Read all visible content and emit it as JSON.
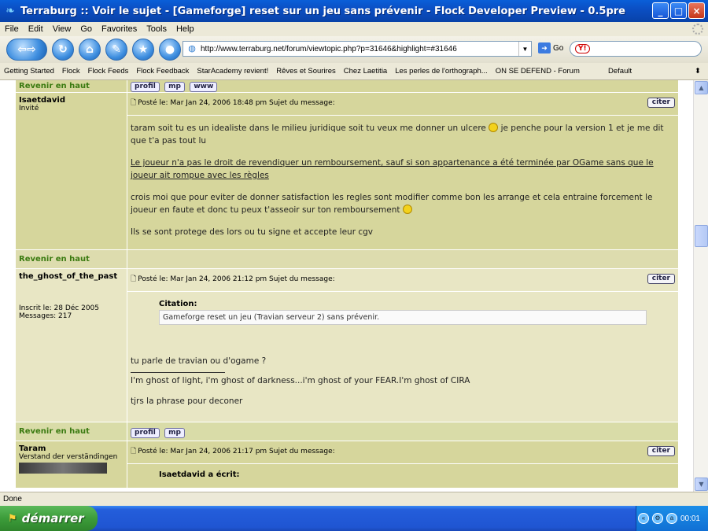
{
  "window": {
    "title": "Terraburg :: Voir le sujet - [Gameforge] reset sur un jeu sans prévenir - Flock Developer Preview - 0.5pre",
    "controls": [
      "_",
      "□",
      "×"
    ]
  },
  "menu": [
    "File",
    "Edit",
    "View",
    "Go",
    "Favorites",
    "Tools",
    "Help"
  ],
  "nav": {
    "url": "http://www.terraburg.net/forum/viewtopic.php?p=31646&highlight=#31646",
    "go_label": "Go",
    "search_engine": "Y!"
  },
  "bookmarks": {
    "items": [
      "Getting Started",
      "Flock",
      "Flock Feeds",
      "Flock Feedback",
      "StarAcademy revient!",
      "Rêves et Sourires",
      "Chez Laetitia",
      "Les perles de l'orthograph...",
      "ON SE DEFEND - Forum"
    ],
    "default": "Default"
  },
  "forum": {
    "revenir_label": "Revenir en haut",
    "buttons": {
      "profil": "profil",
      "mp": "mp",
      "www": "www",
      "citer": "citer"
    },
    "posts": [
      {
        "author": "Isaetdavid",
        "rank": "Invité",
        "header": "Posté le: Mar Jan 24, 2006 18:48 pm    Sujet du message:",
        "paragraphs": [
          "taram soit tu es un idealiste dans le milieu juridique soit tu veux me donner un ulcere",
          "je penche pour la version 1 et je me dit que t'a pas tout lu"
        ],
        "underlined": "Le joueur n'a pas le droit de revendiquer un remboursement, sauf si son appartenance a été terminée par OGame sans que le joueur ait rompue avec les règles",
        "para3": "crois moi que pour eviter de donner satisfaction les regles sont modifier comme bon les arrange et cela entraine forcement le joueur en faute et donc tu peux t'asseoir sur ton remboursement",
        "para4": "Ils se sont protege des lors ou tu signe et accepte leur cgv"
      },
      {
        "author": "the_ghost_of_the_past",
        "inscrit": "Inscrit le: 28 Déc 2005",
        "messages": "Messages: 217",
        "header": "Posté le: Mar Jan 24, 2006 21:12 pm    Sujet du message:",
        "quote_title": "Citation:",
        "quote_body": "Gameforge reset un jeu (Travian serveur 2) sans prévenir.",
        "text1": "tu parle de travian ou d'ogame ?",
        "signature": "I'm ghost of light, i'm ghost of darkness...i'm ghost of your FEAR.I'm ghost of CIRA",
        "sig2": "tjrs la phrase pour deconer"
      },
      {
        "author": "Taram",
        "rank": "Verstand der verständingen",
        "avatar_text": "Terraburg",
        "header": "Posté le: Mar Jan 24, 2006 21:17 pm    Sujet du message:",
        "quote_title": "Isaetdavid a écrit:"
      }
    ]
  },
  "status": "Done",
  "taskbar": {
    "start_label": "démarrer",
    "clock": "00:01"
  }
}
